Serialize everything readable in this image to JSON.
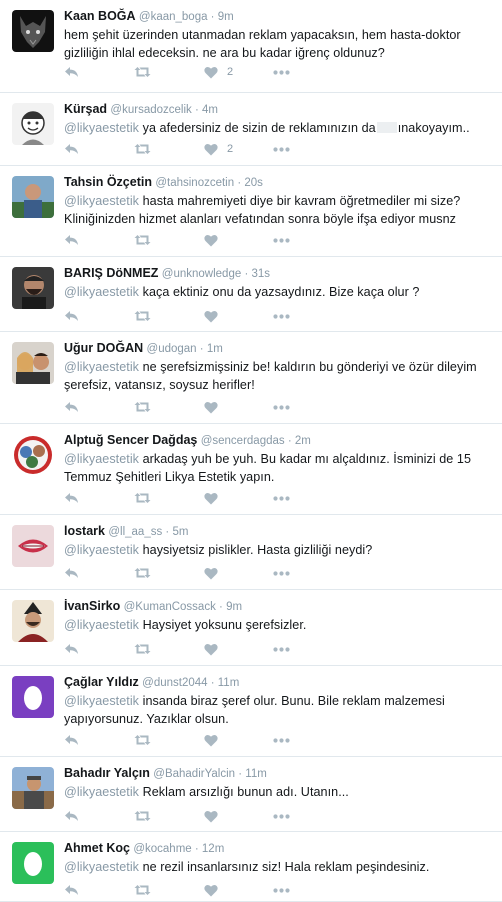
{
  "colors": {
    "text": "#14171a",
    "muted": "#8899a6",
    "icon": "#aab8c2",
    "border": "#e1e8ed",
    "egg_purple": "#7a3fc1",
    "egg_green": "#2bbf5a"
  },
  "tweets": [
    {
      "name": "Kaan BOĞA",
      "handle": "@kaan_boga",
      "time": "9m",
      "mention": "",
      "text_a": "hem şehit üzerinden utanmadan reklam yapacaksın, hem hasta-doktor gizliliğin ihlal edeceksin. ne ara bu kadar iğrenç oldunuz?",
      "text_b": "",
      "likes": "2",
      "avatar_icon": "wolf-avatar-icon"
    },
    {
      "name": "Kürşad",
      "handle": "@kursadozcelik",
      "time": "4m",
      "mention": "@likyaestetik",
      "text_a": "ya afedersiniz de sizin de reklamınızın da",
      "text_b": "ınakoyayım..",
      "likes": "2",
      "avatar_icon": "cartoon-face-avatar-icon"
    },
    {
      "name": "Tahsin Özçetin",
      "handle": "@tahsinozcetin",
      "time": "20s",
      "mention": "@likyaestetik",
      "text_a": "hasta mahremiyeti diye bir kavram öğretmediler mi size? Kliniğinizden hizmet alanları vefatından sonra böyle ifşa ediyor musnz",
      "text_b": "",
      "likes": "",
      "avatar_icon": "user-photo-icon"
    },
    {
      "name": "BARIŞ DöNMEZ",
      "handle": "@unknowledge",
      "time": "31s",
      "mention": "@likyaestetik",
      "text_a": "kaça ektiniz onu da yazsaydınız. Bize kaça olur ?",
      "text_b": "",
      "likes": "",
      "avatar_icon": "user-photo-icon"
    },
    {
      "name": "Uğur DOĞAN",
      "handle": "@udogan",
      "time": "1m",
      "mention": "@likyaestetik",
      "text_a": "ne şerefsizmişsiniz be! kaldırın bu gönderiyi ve özür dileyim şerefsiz, vatansız, soysuz herifler!",
      "text_b": "",
      "likes": "",
      "avatar_icon": "couple-photo-icon"
    },
    {
      "name": "Alptuğ Sencer Dağdaş",
      "handle": "@sencerdagdas",
      "time": "2m",
      "mention": "@likyaestetik",
      "text_a": "arkadaş yuh be yuh. Bu kadar mı alçaldınız. İsminizi de 15 Temmuz Şehitleri  Likya Estetik yapın.",
      "text_b": "",
      "likes": "",
      "avatar_icon": "collage-avatar-icon"
    },
    {
      "name": "lostark",
      "handle": "@ll_aa_ss",
      "time": "5m",
      "mention": "@likyaestetik",
      "text_a": "haysiyetsiz pislikler. Hasta gizliliği neydi?",
      "text_b": "",
      "likes": "",
      "avatar_icon": "lips-avatar-icon"
    },
    {
      "name": "İvanSirko",
      "handle": "@KumanCossack",
      "time": "9m",
      "mention": "@likyaestetik",
      "text_a": "Haysiyet yoksunu şerefsizler.",
      "text_b": "",
      "likes": "",
      "avatar_icon": "painting-avatar-icon"
    },
    {
      "name": "Çağlar Yıldız",
      "handle": "@dunst2044",
      "time": "11m",
      "mention": "@likyaestetik",
      "text_a": "insanda biraz şeref olur. Bunu. Bile reklam malzemesi yapıyorsunuz. Yazıklar olsun.",
      "text_b": "",
      "likes": "",
      "avatar_icon": "default-egg-avatar-icon"
    },
    {
      "name": "Bahadır Yalçın",
      "handle": "@BahadirYalcin",
      "time": "11m",
      "mention": "@likyaestetik",
      "text_a": "Reklam arsızlığı bunun adı. Utanın...",
      "text_b": "",
      "likes": "",
      "avatar_icon": "outdoor-photo-icon"
    },
    {
      "name": "Ahmet Koç",
      "handle": "@kocahme",
      "time": "12m",
      "mention": "@likyaestetik",
      "text_a": "ne rezil insanlarsınız siz! Hala reklam peşindesiniz.",
      "text_b": "",
      "likes": "",
      "avatar_icon": "default-egg-avatar-icon"
    }
  ]
}
